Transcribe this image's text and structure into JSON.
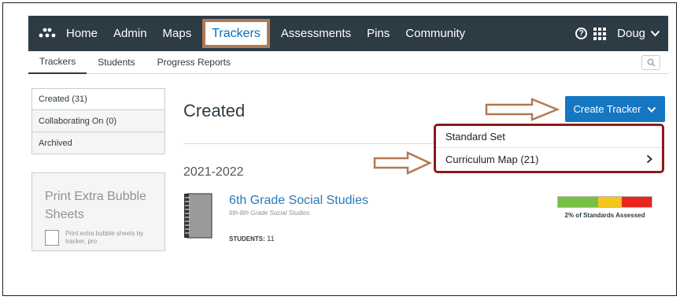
{
  "topnav": {
    "items": [
      {
        "label": "Home"
      },
      {
        "label": "Admin"
      },
      {
        "label": "Maps"
      },
      {
        "label": "Trackers"
      },
      {
        "label": "Assessments"
      },
      {
        "label": "Pins"
      },
      {
        "label": "Community"
      }
    ],
    "active": "Trackers",
    "user": "Doug",
    "help_icon": "question-circle-icon",
    "apps_icon": "grid-icon",
    "user_icon": "chevron-down-icon"
  },
  "subnav": {
    "items": [
      {
        "label": "Trackers"
      },
      {
        "label": "Students"
      },
      {
        "label": "Progress Reports"
      }
    ],
    "search_icon": "search-icon"
  },
  "sidebar": {
    "tabs": [
      {
        "label": "Created (31)"
      },
      {
        "label": "Collaborating On (0)"
      },
      {
        "label": "Archived"
      }
    ],
    "print": {
      "title": "Print Extra Bubble Sheets",
      "text": "Print extra bubble sheets by tracker, pro"
    }
  },
  "main": {
    "heading": "Created",
    "create_button": "Create Tracker",
    "year": "2021-2022",
    "dropdown": [
      {
        "label": "Standard Set"
      },
      {
        "label": "Curriculum Map (21)"
      }
    ],
    "tracker": {
      "title": "6th Grade Social Studies",
      "subtitle": "6th-8th Grade Social Studies",
      "students_label": "STUDENTS:",
      "students_count": "11",
      "progress_label": "2% of Standards Assessed"
    }
  },
  "colors": {
    "nav_bg": "#2d3b45",
    "accent": "#1576c2",
    "highlight_box": "#b07a52",
    "dropdown_border": "#8a1c1c",
    "progress": [
      "#78c041",
      "#f2c51c",
      "#e8261d"
    ]
  }
}
